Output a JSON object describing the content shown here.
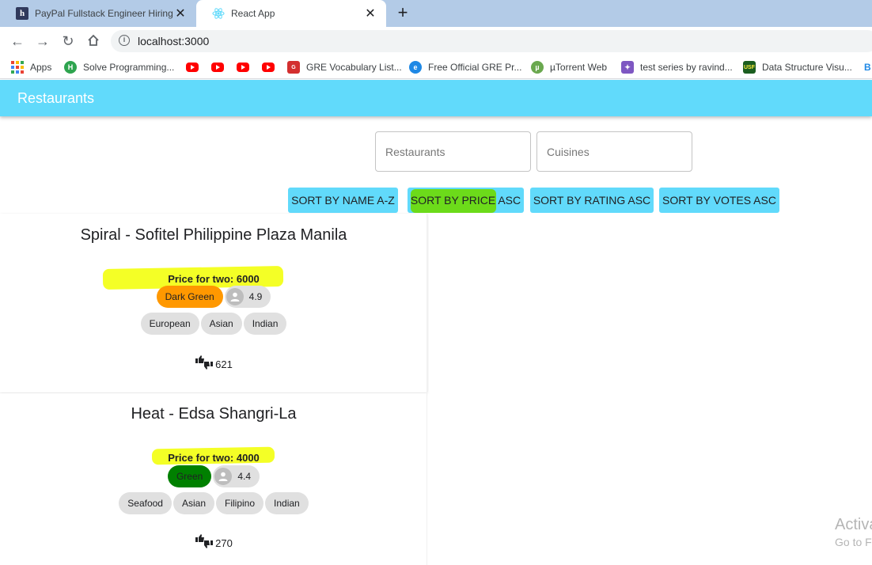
{
  "browser": {
    "tabs": [
      {
        "title": "PayPal Fullstack Engineer Hiring C",
        "icon": "hackerearth-icon"
      },
      {
        "title": "React App",
        "icon": "react-icon"
      }
    ],
    "url": "localhost:3000",
    "bookmarks": [
      {
        "label": "Apps",
        "icon": "apps-grid-icon"
      },
      {
        "label": "Solve Programming...",
        "icon": "hackerearth-green-icon"
      },
      {
        "label": "",
        "icon": "youtube-icon"
      },
      {
        "label": "",
        "icon": "youtube-icon"
      },
      {
        "label": "",
        "icon": "youtube-icon"
      },
      {
        "label": "",
        "icon": "youtube-icon"
      },
      {
        "label": "GRE Vocabulary List...",
        "icon": "gre-icon"
      },
      {
        "label": "Free Official GRE Pr...",
        "icon": "ets-icon"
      },
      {
        "label": "µTorrent Web",
        "icon": "utorrent-icon"
      },
      {
        "label": "test series by ravind...",
        "icon": "butterfly-icon"
      },
      {
        "label": "Data Structure Visu...",
        "icon": "usf-icon"
      },
      {
        "label": "B",
        "icon": "bing-icon"
      }
    ]
  },
  "app": {
    "title": "Restaurants",
    "search": {
      "restaurants_placeholder": "Restaurants",
      "cuisines_placeholder": "Cuisines"
    },
    "sort_buttons": [
      "SORT BY NAME A-Z",
      "SORT BY PRICE ASC",
      "SORT BY RATING ASC",
      "SORT BY VOTES ASC"
    ],
    "restaurants": [
      {
        "name": "Spiral - Sofitel Philippine Plaza Manila",
        "price_text": "Price for two: 6000",
        "rating_color_text": "Dark Green",
        "rating": "4.9",
        "cuisines": [
          "European",
          "Asian",
          "Indian"
        ],
        "votes": "621",
        "colors": {
          "rating_chip": "#ff9800"
        }
      },
      {
        "name": "Heat - Edsa Shangri-La",
        "price_text": "Price for two: 4000",
        "rating_color_text": "Green",
        "rating": "4.4",
        "cuisines": [
          "Seafood",
          "Asian",
          "Filipino",
          "Indian"
        ],
        "votes": "270",
        "colors": {
          "rating_chip": "#008000"
        }
      }
    ]
  },
  "watermark": {
    "line1": "Activa",
    "line2": "Go to F"
  },
  "colors": {
    "accent": "#61dafb",
    "highlight_yellow": "#f4ff26",
    "highlight_green": "#6cdb1a",
    "tabstrip": "#b3cbe7"
  }
}
